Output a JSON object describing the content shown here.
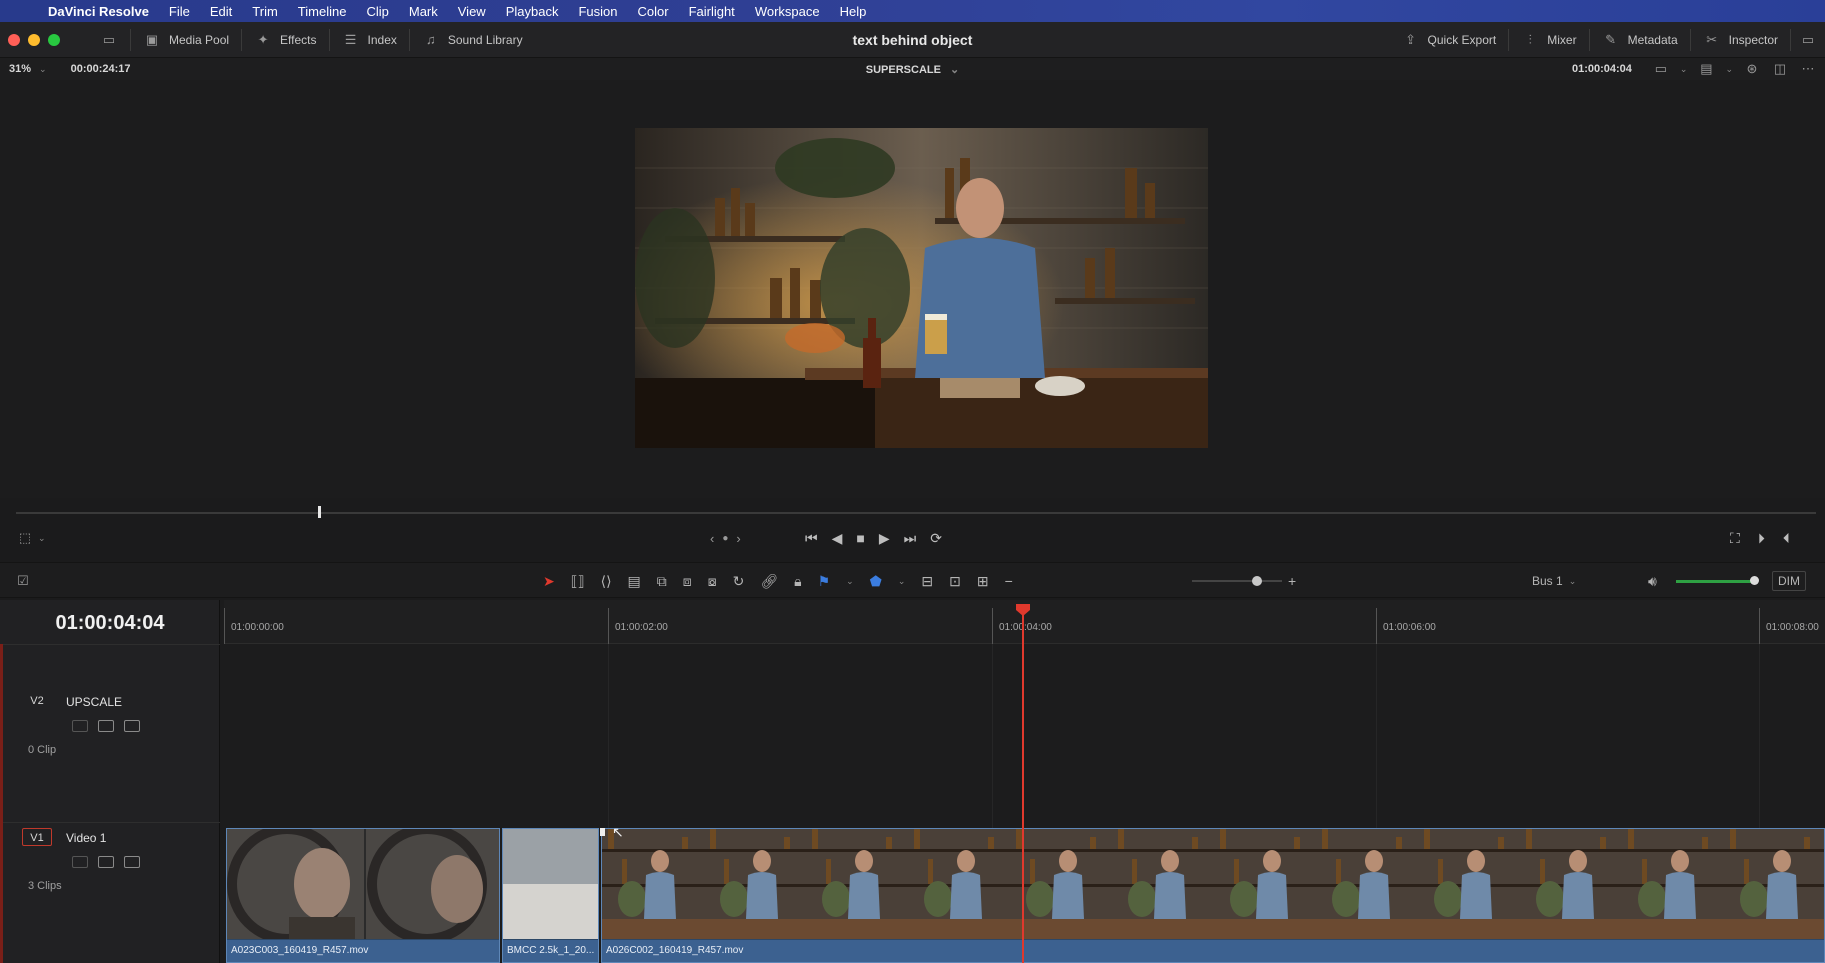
{
  "menubar": {
    "app_name": "DaVinci Resolve",
    "items": [
      "File",
      "Edit",
      "Trim",
      "Timeline",
      "Clip",
      "Mark",
      "View",
      "Playback",
      "Fusion",
      "Color",
      "Fairlight",
      "Workspace",
      "Help"
    ]
  },
  "toolbar": {
    "left": [
      {
        "label": "Media Pool",
        "icon": "media-pool-icon"
      },
      {
        "label": "Effects",
        "icon": "effects-wand-icon"
      },
      {
        "label": "Index",
        "icon": "index-list-icon"
      },
      {
        "label": "Sound Library",
        "icon": "sound-library-icon"
      }
    ],
    "project_title": "text behind object",
    "right": [
      {
        "label": "Quick Export",
        "icon": "export-icon"
      },
      {
        "label": "Mixer",
        "icon": "mixer-icon"
      },
      {
        "label": "Metadata",
        "icon": "metadata-icon"
      },
      {
        "label": "Inspector",
        "icon": "inspector-icon"
      }
    ]
  },
  "viewer": {
    "zoom": "31%",
    "duration_timecode": "00:00:24:17",
    "clip_name": "SUPERSCALE",
    "current_timecode": "01:00:04:04"
  },
  "transport": {
    "buttons": [
      "go-to-start",
      "play-reverse",
      "stop",
      "play",
      "go-to-end",
      "loop"
    ]
  },
  "edit_toolbar": {
    "audio_bus": "Bus 1",
    "dim_label": "DIM"
  },
  "timeline": {
    "current_timecode": "01:00:04:04",
    "ruler_ticks": [
      "01:00:00:00",
      "01:00:02:00",
      "01:00:04:00",
      "01:00:06:00",
      "01:00:08:00"
    ],
    "tracks": [
      {
        "id": "V2",
        "name": "UPSCALE",
        "clip_count": "0 Clip"
      },
      {
        "id": "V1",
        "name": "Video 1",
        "clip_count": "3 Clips"
      }
    ],
    "clips": [
      {
        "name": "A023C003_160419_R457.mov"
      },
      {
        "name": "BMCC 2.5k_1_20..."
      },
      {
        "name": "A026C002_160419_R457.mov"
      }
    ]
  },
  "colors": {
    "playhead": "#e0392d",
    "clip_body": "#2c4766",
    "clip_label": "#3c6190",
    "menubar": "#2f3f94"
  }
}
